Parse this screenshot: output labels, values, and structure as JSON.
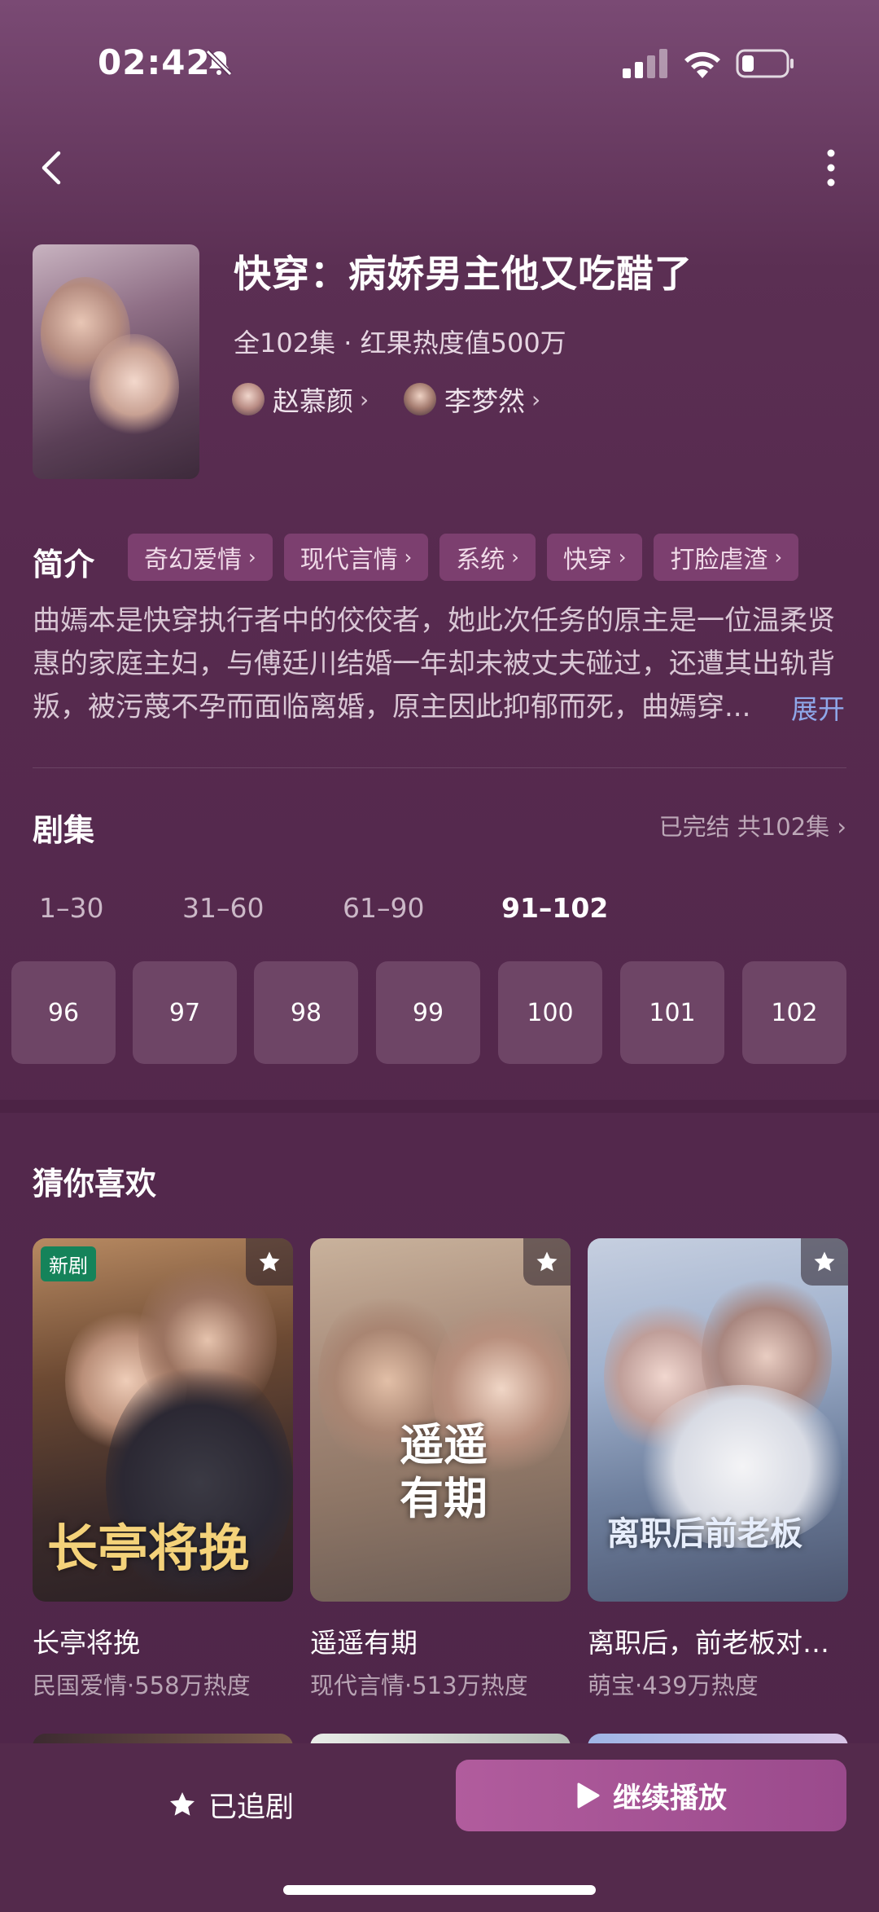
{
  "status_bar": {
    "time": "02:42"
  },
  "drama": {
    "title": "快穿：病娇男主他又吃醋了",
    "meta": "全102集 · 红果热度值500万",
    "actors": [
      {
        "name": "赵慕颜"
      },
      {
        "name": "李梦然"
      }
    ]
  },
  "intro": {
    "heading": "简介",
    "tags": [
      "奇幻爱情",
      "现代言情",
      "系统",
      "快穿",
      "打脸虐渣"
    ],
    "lines": [
      "曲嫣本是快穿执行者中的佼佼者，她此次任务的原主是一位温柔贤",
      "惠的家庭主妇，与傅廷川结婚一年却未被丈夫碰过，还遭其出轨背",
      "叛，被污蔑不孕而面临离婚，原主因此抑郁而死，曲嫣穿..."
    ],
    "expand": "展开"
  },
  "episodes": {
    "heading": "剧集",
    "status": "已完结 共102集",
    "ranges": [
      "1–30",
      "31–60",
      "61–90",
      "91–102"
    ],
    "active_range": "91–102",
    "items": [
      "96",
      "97",
      "98",
      "99",
      "100",
      "101",
      "102"
    ]
  },
  "recommend": {
    "heading": "猜你喜欢",
    "new_badge": "新剧",
    "cards": [
      {
        "title": "长亭将挽",
        "sub": "民国爱情·558万热度",
        "poster_text": "长亭将挽"
      },
      {
        "title": "遥遥有期",
        "sub": "现代言情·513万热度",
        "poster_text": "遥遥有期"
      },
      {
        "title": "离职后，前老板对…",
        "sub": "萌宝·439万热度",
        "poster_text": "离职后前老板"
      }
    ]
  },
  "bottom": {
    "follow_label": "已追剧",
    "play_label": "继续播放"
  }
}
